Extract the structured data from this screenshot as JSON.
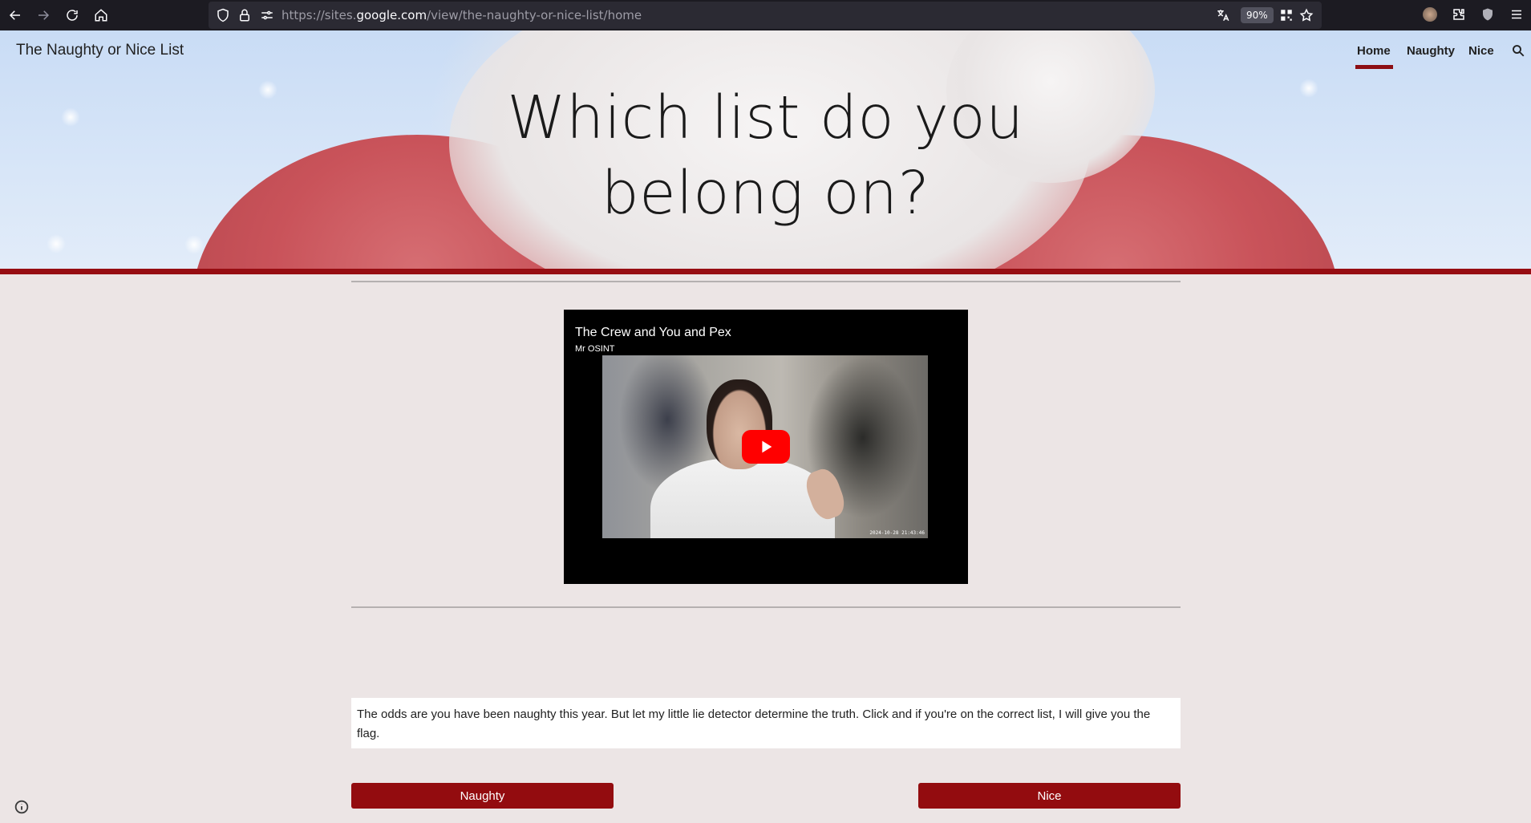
{
  "browser": {
    "url_scheme_prefix": "https://sites.",
    "url_host": "google.com",
    "url_path": "/view/the-naughty-or-nice-list/home",
    "zoom": "90%"
  },
  "site": {
    "title": "The Naughty or Nice List",
    "nav": [
      {
        "label": "Home",
        "active": true
      },
      {
        "label": "Naughty",
        "active": false
      },
      {
        "label": "Nice",
        "active": false
      }
    ],
    "heading_line1": "Which list do you",
    "heading_line2": "belong on?"
  },
  "video": {
    "title": "The Crew and You and Pex",
    "channel": "Mr OSINT",
    "timestamp": "2024-10-28 21:43:46"
  },
  "message": "The odds are you have been naughty this year. But let my little lie detector determine the truth. Click and if you're on the correct list, I will give you the flag.",
  "buttons": {
    "naughty": "Naughty",
    "nice": "Nice"
  },
  "colors": {
    "accent": "#930c0f",
    "page_bg": "#ece5e5"
  }
}
